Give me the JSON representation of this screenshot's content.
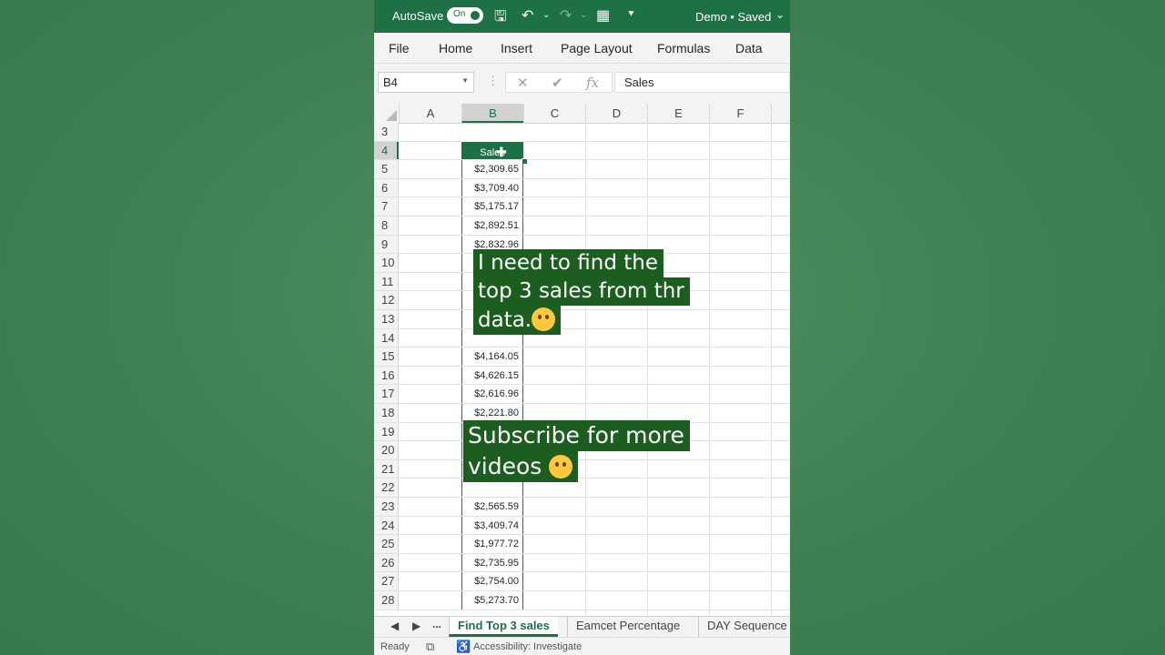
{
  "titlebar": {
    "autosave_label": "AutoSave",
    "autosave_state": "On",
    "doc_title": "Demo • Saved"
  },
  "menu": [
    "File",
    "Home",
    "Insert",
    "Page Layout",
    "Formulas",
    "Data"
  ],
  "formula_bar": {
    "name_box": "B4",
    "content": "Sales"
  },
  "columns": [
    "A",
    "B",
    "C",
    "D",
    "E",
    "F"
  ],
  "selected_column": "B",
  "selected_row": "4",
  "rows": [
    {
      "num": "3",
      "b": ""
    },
    {
      "num": "4",
      "b": "Sales"
    },
    {
      "num": "5",
      "b": "$2,309.65"
    },
    {
      "num": "6",
      "b": "$3,709.40"
    },
    {
      "num": "7",
      "b": "$5,175.17"
    },
    {
      "num": "8",
      "b": "$2,892.51"
    },
    {
      "num": "9",
      "b": "$2,832.96"
    },
    {
      "num": "10",
      "b": ""
    },
    {
      "num": "11",
      "b": ""
    },
    {
      "num": "12",
      "b": ""
    },
    {
      "num": "13",
      "b": ""
    },
    {
      "num": "14",
      "b": ""
    },
    {
      "num": "15",
      "b": "$4,164.05"
    },
    {
      "num": "16",
      "b": "$4,626.15"
    },
    {
      "num": "17",
      "b": "$2,616.96"
    },
    {
      "num": "18",
      "b": "$2,221.80"
    },
    {
      "num": "19",
      "b": ""
    },
    {
      "num": "20",
      "b": ""
    },
    {
      "num": "21",
      "b": ""
    },
    {
      "num": "22",
      "b": ""
    },
    {
      "num": "23",
      "b": "$2,565.59"
    },
    {
      "num": "24",
      "b": "$3,409.74"
    },
    {
      "num": "25",
      "b": "$1,977.72"
    },
    {
      "num": "26",
      "b": "$2,735.95"
    },
    {
      "num": "27",
      "b": "$2,754.00"
    },
    {
      "num": "28",
      "b": "$5,273.70"
    }
  ],
  "captions": {
    "first": [
      "I need to find the",
      "top 3 sales from thr",
      "data."
    ],
    "second": [
      "Subscribe for more",
      "videos"
    ]
  },
  "sheet_tabs": {
    "more": "...",
    "tabs": [
      "Find Top 3 sales",
      "Eamcet Percentage",
      "DAY Sequence"
    ],
    "active": "Find Top 3 sales"
  },
  "status": {
    "ready": "Ready",
    "accessibility": "Accessibility: Investigate"
  },
  "colors": {
    "excel_green": "#1e7145",
    "caption_bg": "#1b5e20",
    "background": "#3f8155"
  }
}
